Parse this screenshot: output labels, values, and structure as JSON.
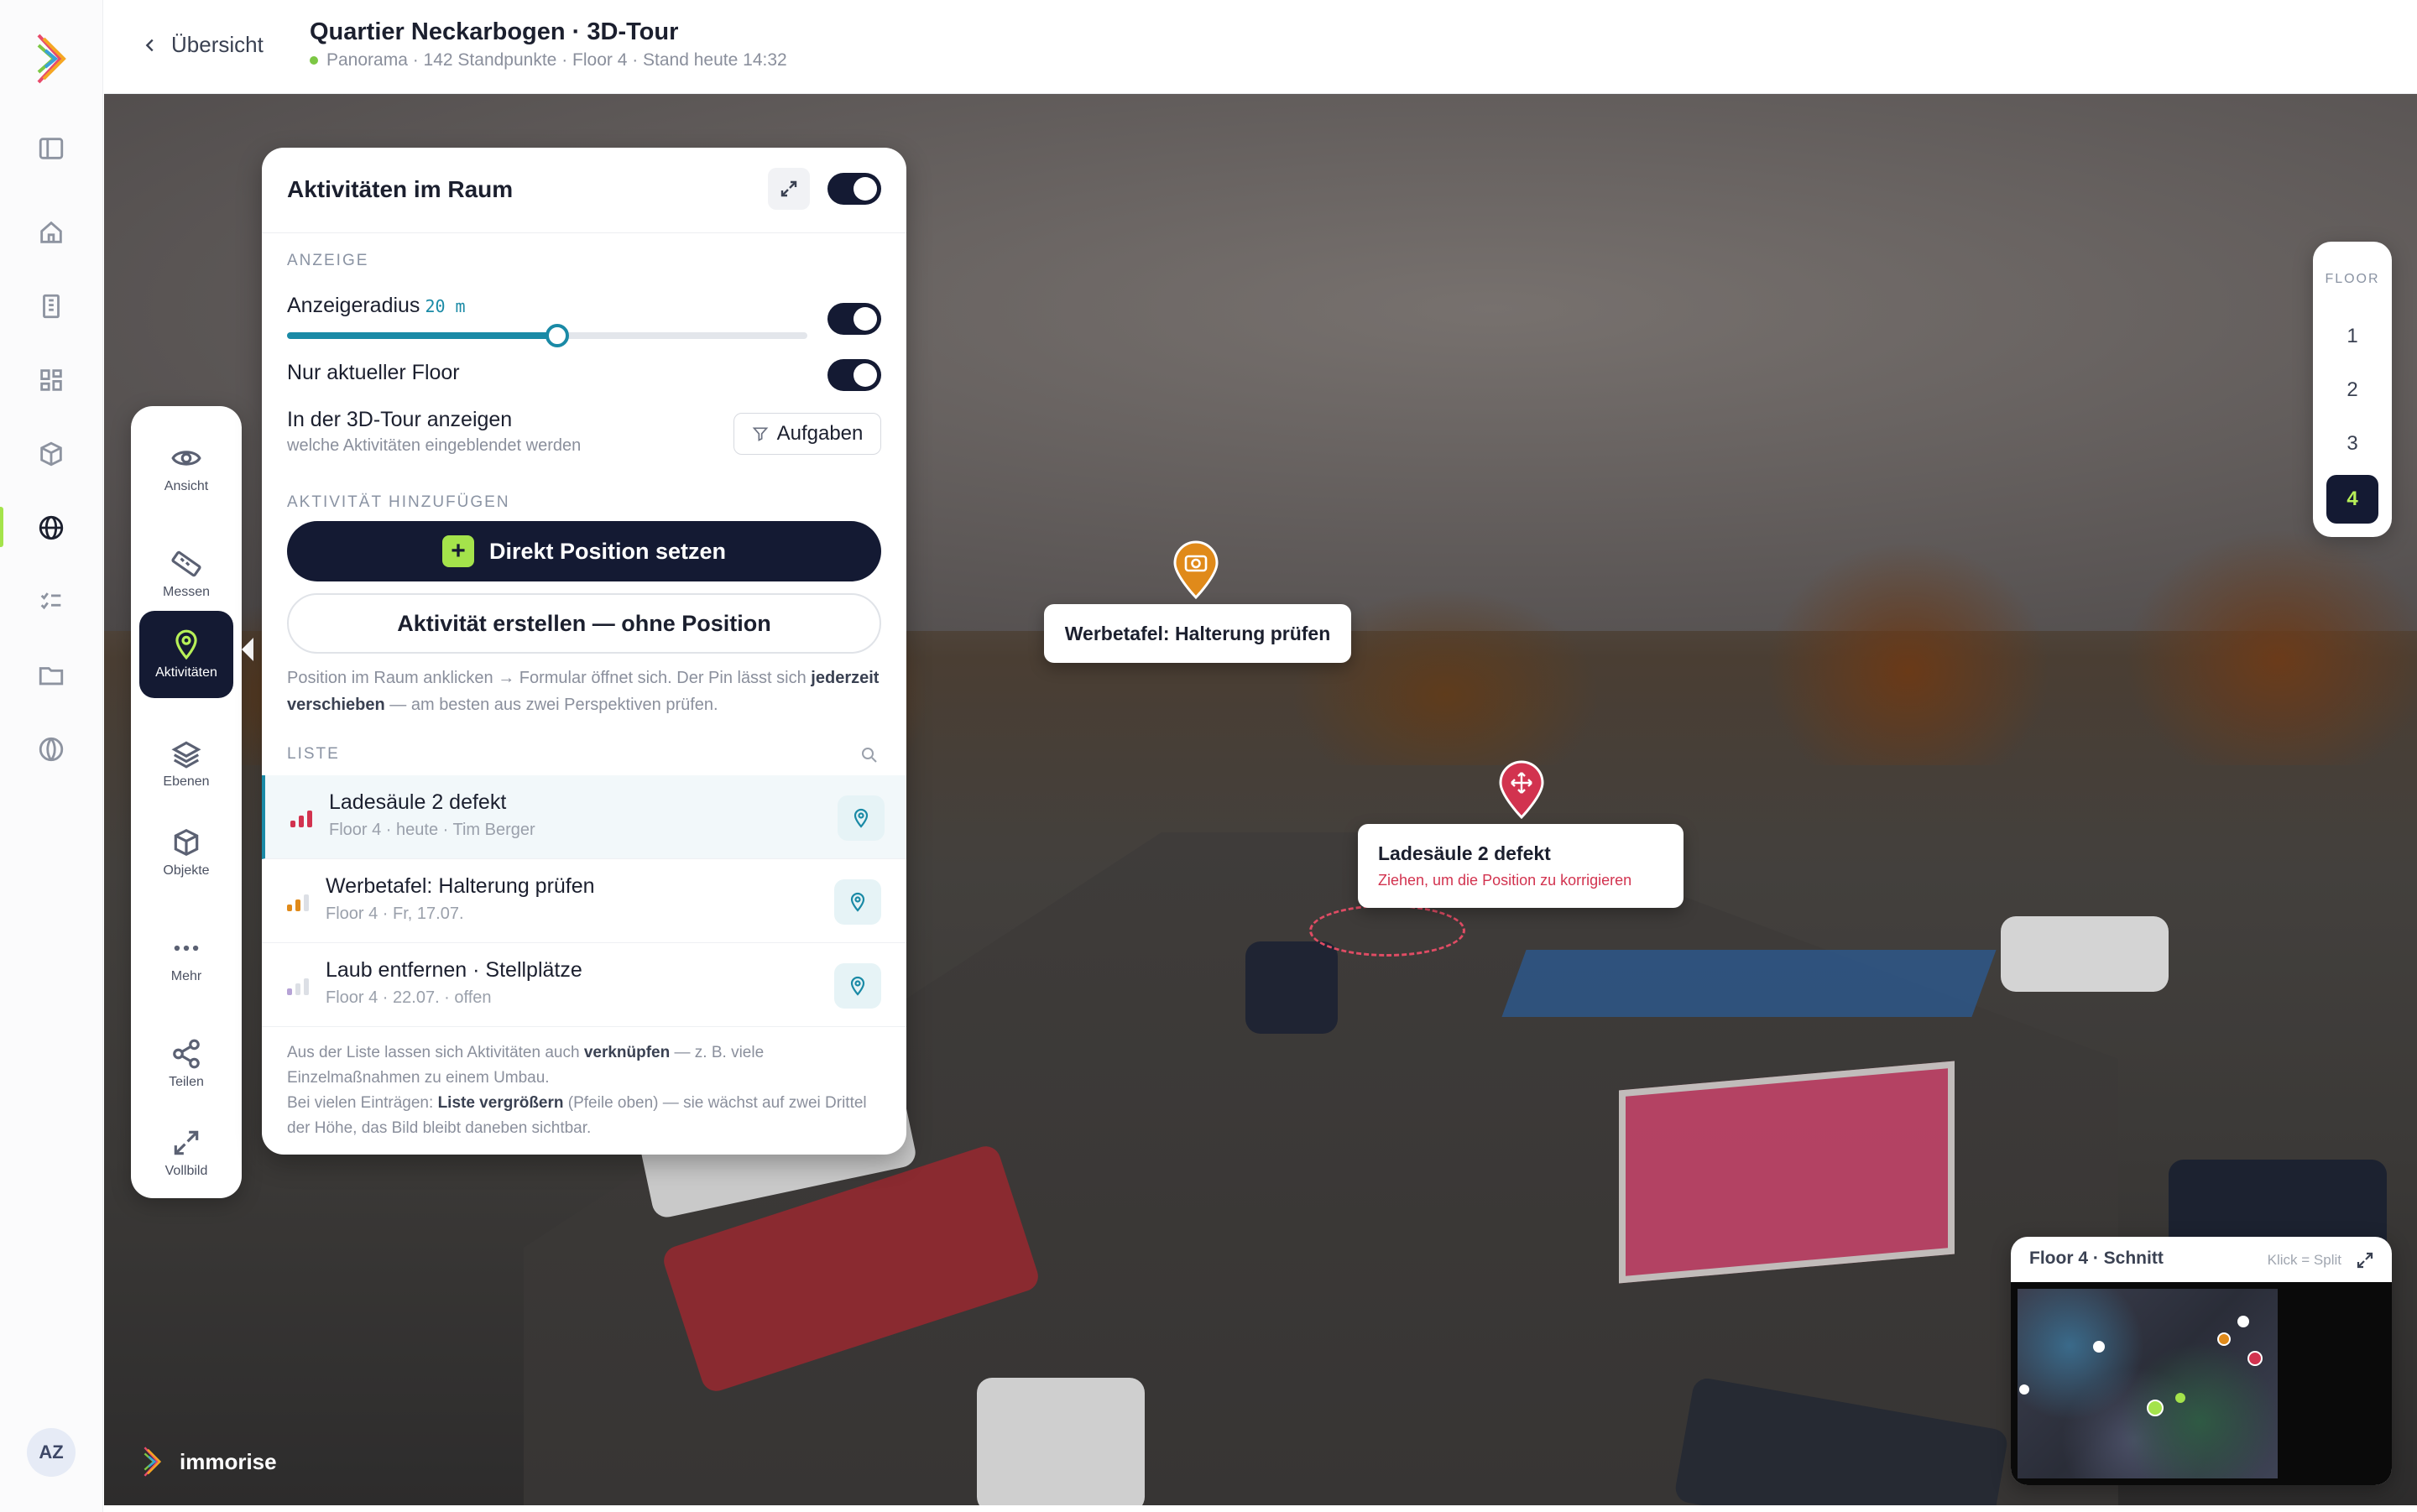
{
  "header": {
    "back_label": "Übersicht",
    "title": "Quartier Neckarbogen · 3D-Tour",
    "subtitle": "Panorama · 142 Standpunkte · Floor 4 · Stand heute 14:32"
  },
  "rail": {
    "avatar_initials": "AZ",
    "icons": [
      "sidebar-toggle-icon",
      "home-icon",
      "building-icon",
      "grid-icon",
      "cube-icon",
      "globe-icon",
      "checklist-icon",
      "folder-icon",
      "world-icon"
    ],
    "active_item": "globe-icon"
  },
  "tools": [
    {
      "label": "Ansicht",
      "icon": "eye-icon"
    },
    {
      "label": "Messen",
      "icon": "ruler-icon"
    },
    {
      "label": "Aktivitäten",
      "icon": "map-pin-icon",
      "active": true
    },
    {
      "label": "Ebenen",
      "icon": "layers-icon"
    },
    {
      "label": "Objekte",
      "icon": "box-icon"
    },
    {
      "label": "Mehr",
      "icon": "more-icon"
    },
    {
      "label": "Teilen",
      "icon": "share-icon"
    },
    {
      "label": "Vollbild",
      "icon": "fullscreen-icon"
    }
  ],
  "panel": {
    "title": "Aktivitäten im Raum",
    "enabled": true,
    "display_section": "ANZEIGE",
    "radius_label": "Anzeigeradius",
    "radius_value": "20 m",
    "radius_fraction": 0.52,
    "radius_enabled": true,
    "current_floor_label": "Nur aktueller Floor",
    "current_floor_enabled": true,
    "tour_label": "In der 3D-Tour anzeigen",
    "tour_help": "welche Aktivitäten eingeblendet werden",
    "filter_label": "Aufgaben",
    "add_section": "AKTIVITÄT HINZUFÜGEN",
    "primary_button": "Direkt Position setzen",
    "secondary_button": "Aktivität erstellen — ohne Position",
    "hint_1a": "Position im Raum anklicken → Formular öffnet sich. Der Pin lässt sich ",
    "hint_1b": "jederzeit verschieben",
    "hint_1c": " — am besten aus zwei Perspektiven prüfen.",
    "list_section": "LISTE",
    "items": [
      {
        "title": "Ladesäule 2 defekt",
        "sub": "Floor 4 · heute · Tim Berger",
        "priority_color": "#d2334f",
        "priority_level": 3
      },
      {
        "title": "Werbetafel: Halterung prüfen",
        "sub": "Floor 4 · Fr, 17.07.",
        "priority_color": "#e08a1a",
        "priority_level": 2
      },
      {
        "title": "Laub entfernen · Stellplätze",
        "sub": "Floor 4 · 22.07. · offen",
        "priority_color": "#b6a3d6",
        "priority_level": 1
      }
    ],
    "footer_1a": "Aus der Liste lassen sich Aktivitäten auch ",
    "footer_1b": "verknüpfen",
    "footer_1c": " — z. B. viele Einzelmaßnahmen zu einem Umbau.",
    "footer_2a": "Bei vielen Einträgen: ",
    "footer_2b": "Liste vergrößern",
    "footer_2c": " (Pfeile oben) — sie wächst auf zwei Drittel der Höhe, das Bild bleibt daneben sichtbar."
  },
  "floors": {
    "label": "FLOOR",
    "items": [
      "1",
      "2",
      "3",
      "4"
    ],
    "active": "4"
  },
  "pins": {
    "werbetafel": {
      "title": "Werbetafel: Halterung prüfen",
      "color": "#e08a1a",
      "icon": "camera-icon"
    },
    "ladesaeule": {
      "title": "Ladesäule 2 defekt",
      "sub": "Ziehen, um die Position zu korrigieren",
      "color": "#d2334f",
      "icon": "move-icon"
    }
  },
  "minimap": {
    "title": "Floor 4 · Schnitt",
    "hint": "Klick = Split"
  },
  "brand": {
    "name": "immorise"
  }
}
